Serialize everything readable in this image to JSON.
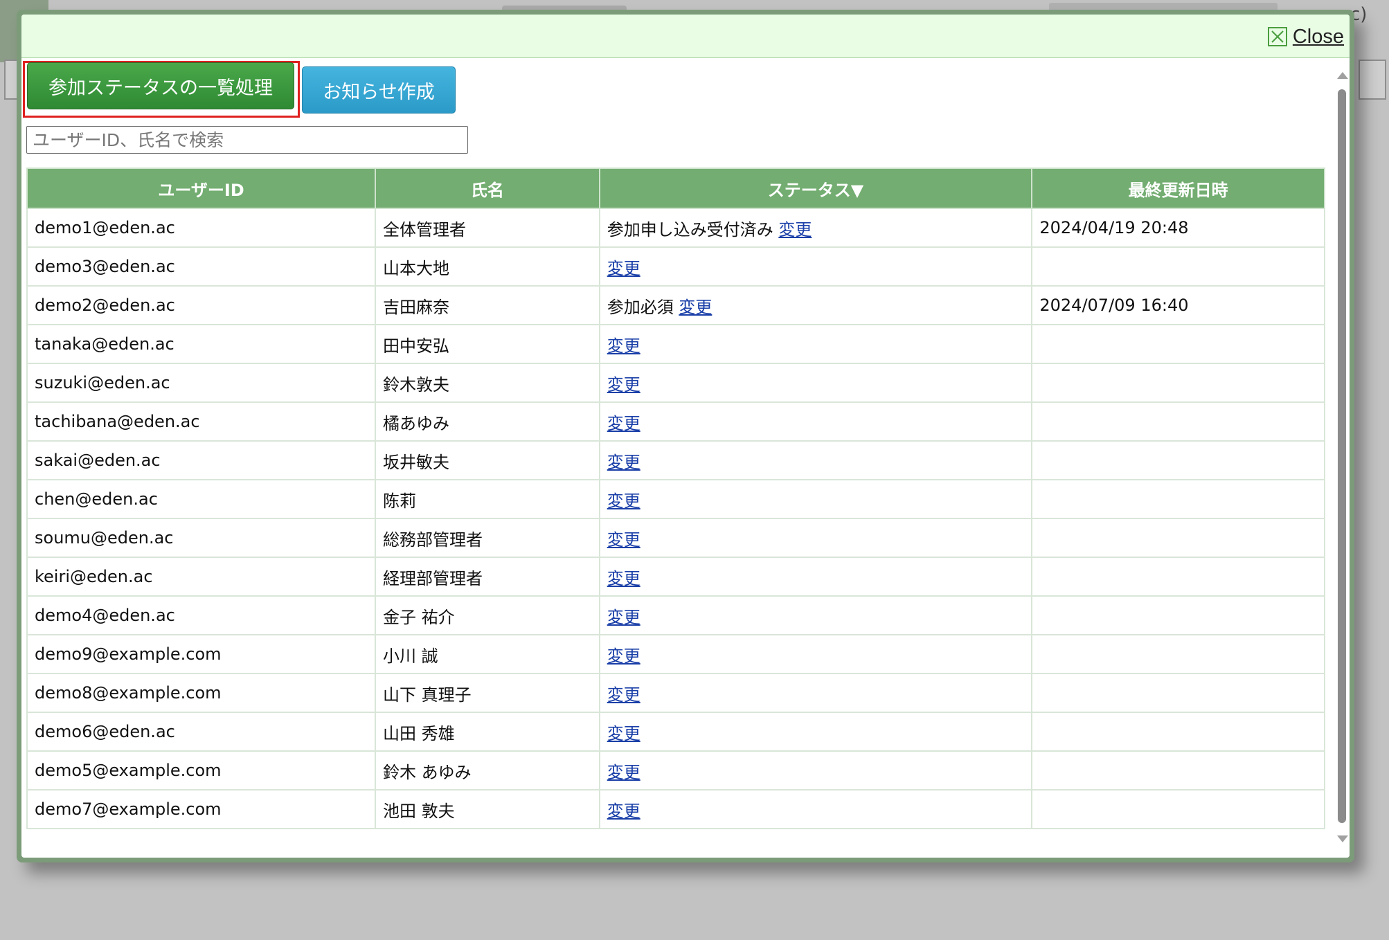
{
  "background": {
    "corner_text": "c)"
  },
  "dialog": {
    "close_label": "Close",
    "bulk_status_button": "参加ステータスの一覧処理",
    "create_notice_button": "お知らせ作成",
    "search_placeholder": "ユーザーID、氏名で検索",
    "table": {
      "headers": [
        "ユーザーID",
        "氏名",
        "ステータス▼",
        "最終更新日時"
      ],
      "change_link_label": "変更",
      "rows": [
        {
          "user_id": "demo1@eden.ac",
          "name": "全体管理者",
          "status": "参加申し込み受付済み",
          "updated": "2024/04/19 20:48"
        },
        {
          "user_id": "demo3@eden.ac",
          "name": "山本大地",
          "status": "",
          "updated": ""
        },
        {
          "user_id": "demo2@eden.ac",
          "name": "吉田麻奈",
          "status": "参加必須",
          "updated": "2024/07/09 16:40"
        },
        {
          "user_id": "tanaka@eden.ac",
          "name": "田中安弘",
          "status": "",
          "updated": ""
        },
        {
          "user_id": "suzuki@eden.ac",
          "name": "鈴木敦夫",
          "status": "",
          "updated": ""
        },
        {
          "user_id": "tachibana@eden.ac",
          "name": "橘あゆみ",
          "status": "",
          "updated": ""
        },
        {
          "user_id": "sakai@eden.ac",
          "name": "坂井敏夫",
          "status": "",
          "updated": ""
        },
        {
          "user_id": "chen@eden.ac",
          "name": "陈莉",
          "status": "",
          "updated": ""
        },
        {
          "user_id": "soumu@eden.ac",
          "name": "総務部管理者",
          "status": "",
          "updated": ""
        },
        {
          "user_id": "keiri@eden.ac",
          "name": "経理部管理者",
          "status": "",
          "updated": ""
        },
        {
          "user_id": "demo4@eden.ac",
          "name": "金子 祐介",
          "status": "",
          "updated": ""
        },
        {
          "user_id": "demo9@example.com",
          "name": "小川 誠",
          "status": "",
          "updated": ""
        },
        {
          "user_id": "demo8@example.com",
          "name": "山下 真理子",
          "status": "",
          "updated": ""
        },
        {
          "user_id": "demo6@eden.ac",
          "name": "山田 秀雄",
          "status": "",
          "updated": ""
        },
        {
          "user_id": "demo5@example.com",
          "name": "鈴木 あゆみ",
          "status": "",
          "updated": ""
        },
        {
          "user_id": "demo7@example.com",
          "name": "池田 敦夫",
          "status": "",
          "updated": ""
        }
      ]
    }
  },
  "colors": {
    "header_green": "#73ad71",
    "bulk_button_green": "#3a9a3e",
    "notice_button_blue": "#38a8d6",
    "highlight_red": "#e02020",
    "link_blue": "#1a3fa8"
  },
  "icons": {
    "close": "close-icon"
  }
}
